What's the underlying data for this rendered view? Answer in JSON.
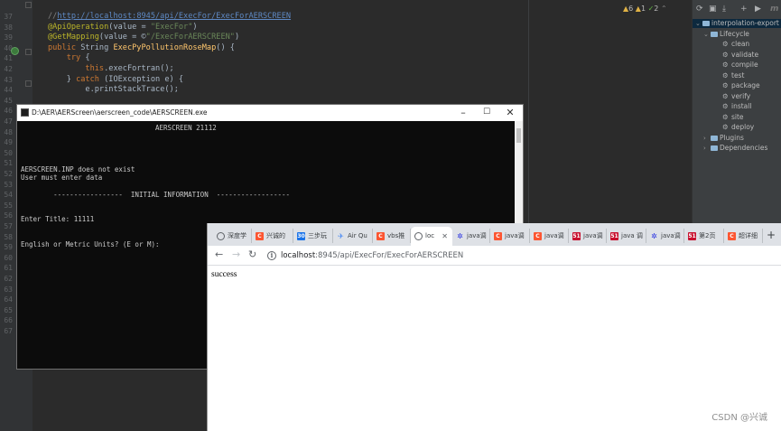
{
  "ide": {
    "line_numbers": [
      "37",
      "38",
      "39",
      "40",
      "41",
      "42",
      "43",
      "44",
      "45",
      "46",
      "47",
      "48",
      "49",
      "50",
      "51",
      "52",
      "53",
      "54",
      "55",
      "56",
      "57",
      "58",
      "59",
      "60",
      "61",
      "62",
      "63",
      "64",
      "65",
      "66",
      "67"
    ],
    "code_lines": [
      {
        "indent": "",
        "parts": [
          {
            "t": "cm",
            "v": "//"
          },
          {
            "t": "lk",
            "v": "http://localhost:8945/api/ExecFor/ExecForAERSCREEN"
          }
        ]
      },
      {
        "indent": "",
        "parts": [
          {
            "t": "an",
            "v": "@ApiOperation"
          },
          {
            "t": "tx",
            "v": "(value = "
          },
          {
            "t": "st",
            "v": "\"ExecFor\""
          },
          {
            "t": "tx",
            "v": ")"
          }
        ]
      },
      {
        "indent": "",
        "parts": [
          {
            "t": "an",
            "v": "@GetMapping"
          },
          {
            "t": "tx",
            "v": "(value = ©"
          },
          {
            "t": "st",
            "v": "\"/ExecForAERSCREEN\""
          },
          {
            "t": "tx",
            "v": ")"
          }
        ]
      },
      {
        "indent": "",
        "parts": [
          {
            "t": "kw",
            "v": "public "
          },
          {
            "t": "tx",
            "v": "String "
          },
          {
            "t": "fn",
            "v": "ExecPyPollutionRoseMap"
          },
          {
            "t": "tx",
            "v": "() {"
          }
        ]
      },
      {
        "indent": "    ",
        "parts": [
          {
            "t": "kw",
            "v": "try "
          },
          {
            "t": "tx",
            "v": "{"
          }
        ]
      },
      {
        "indent": "        ",
        "parts": [
          {
            "t": "kw",
            "v": "this"
          },
          {
            "t": "tx",
            "v": ".execFortran();"
          }
        ]
      },
      {
        "indent": "    ",
        "parts": [
          {
            "t": "tx",
            "v": "} "
          },
          {
            "t": "kw",
            "v": "catch "
          },
          {
            "t": "tx",
            "v": "(IOException e) {"
          }
        ]
      },
      {
        "indent": "        ",
        "parts": [
          {
            "t": "tx",
            "v": "e.printStackTrace();"
          }
        ]
      }
    ],
    "inspections": {
      "warnings": "6",
      "weak_warnings": "1",
      "ok": "2"
    }
  },
  "maven": {
    "toolbar_icons": [
      "refresh-icon",
      "folder-icon",
      "download-icon",
      "plus-icon",
      "run-icon",
      "maven-icon"
    ],
    "project": "interpolation-export",
    "lifecycle_label": "Lifecycle",
    "goals": [
      "clean",
      "validate",
      "compile",
      "test",
      "package",
      "verify",
      "install",
      "site",
      "deploy"
    ],
    "plugins_label": "Plugins",
    "dependencies_label": "Dependencies"
  },
  "console": {
    "title": "D:\\AER\\AERScreen\\aerscreen_code\\AERSCREEN.exe",
    "lines": [
      "                                 AERSCREEN 21112",
      "",
      "",
      "",
      "",
      "AERSCREEN.INP does not exist",
      "User must enter data",
      "",
      "        -----------------  INITIAL INFORMATION  ------------------",
      "",
      "",
      "Enter Title: 11111",
      "",
      "",
      "English or Metric Units? (E or M):"
    ]
  },
  "browser": {
    "tabs": [
      {
        "icon": "globe",
        "label": "深度学"
      },
      {
        "icon": "csdn",
        "label": "兴诚的"
      },
      {
        "icon": "t30",
        "label": "三步玩"
      },
      {
        "icon": "air",
        "label": "Air Qu"
      },
      {
        "icon": "csdn",
        "label": "vbs推"
      },
      {
        "icon": "globe",
        "label": "loc",
        "active": true
      },
      {
        "icon": "bd",
        "label": "java调"
      },
      {
        "icon": "csdn",
        "label": "java调"
      },
      {
        "icon": "csdn",
        "label": "java调"
      },
      {
        "icon": "s51",
        "label": "java调"
      },
      {
        "icon": "s51",
        "label": "java 调"
      },
      {
        "icon": "bd",
        "label": "java调"
      },
      {
        "icon": "s51",
        "label": "第2页"
      },
      {
        "icon": "csdn",
        "label": "超详细"
      }
    ],
    "url_host": "localhost",
    "url_path": ":8945/api/ExecFor/ExecForAERSCREEN",
    "content": "success"
  },
  "watermark": "CSDN @兴诚"
}
